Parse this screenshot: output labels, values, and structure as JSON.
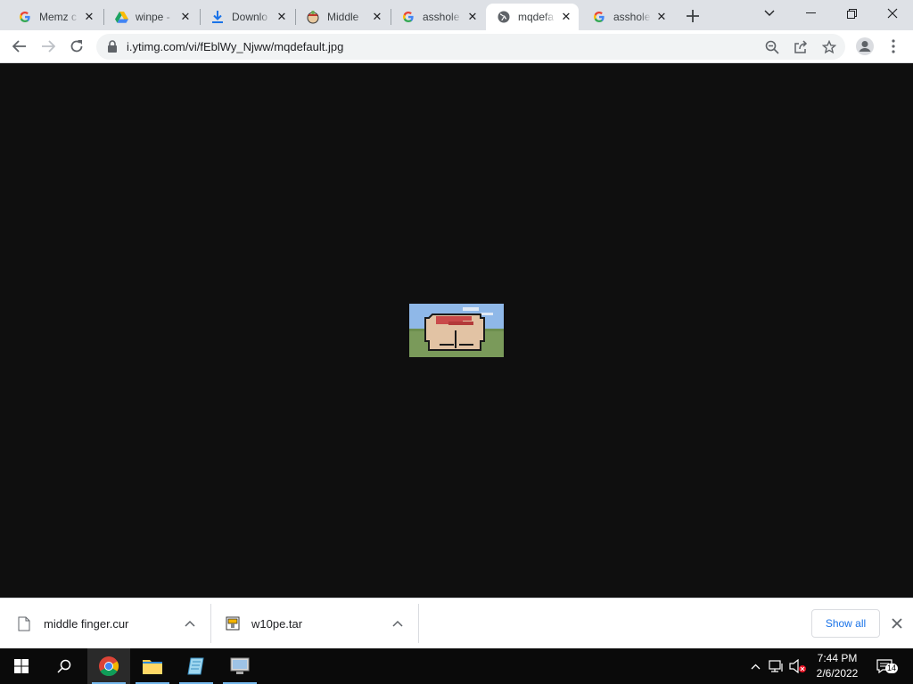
{
  "tabs": [
    {
      "title": "Memz c",
      "icon": "google-g-icon",
      "active": false
    },
    {
      "title": "winpe -",
      "icon": "google-drive-icon",
      "active": false
    },
    {
      "title": "Downlo",
      "icon": "download-icon",
      "active": false
    },
    {
      "title": "Middle",
      "icon": "pixel-art-favicon",
      "active": false
    },
    {
      "title": "asshole",
      "icon": "google-g-icon",
      "active": false
    },
    {
      "title": "mqdefa",
      "icon": "globe-icon",
      "active": true
    },
    {
      "title": "asshole",
      "icon": "google-g-icon",
      "active": false
    }
  ],
  "toolbar": {
    "url": "i.ytimg.com/vi/fEblWy_Njww/mqdefault.jpg"
  },
  "downloads": {
    "items": [
      {
        "name": "middle finger.cur",
        "icon": "file-icon"
      },
      {
        "name": "w10pe.tar",
        "icon": "archive-icon"
      }
    ],
    "show_all_label": "Show all"
  },
  "taskbar": {
    "time": "7:44 PM",
    "date": "2/6/2022",
    "notification_count": "14",
    "apps": [
      "windows-start-icon",
      "search-icon",
      "chrome-icon",
      "file-explorer-icon",
      "notepad-icon",
      "remote-desktop-icon"
    ]
  },
  "colors": {
    "tab_strip": "#dee1e6",
    "page_background": "#0f0f0f",
    "taskbar": "#0a0a0a",
    "link_blue": "#1a73e8"
  }
}
